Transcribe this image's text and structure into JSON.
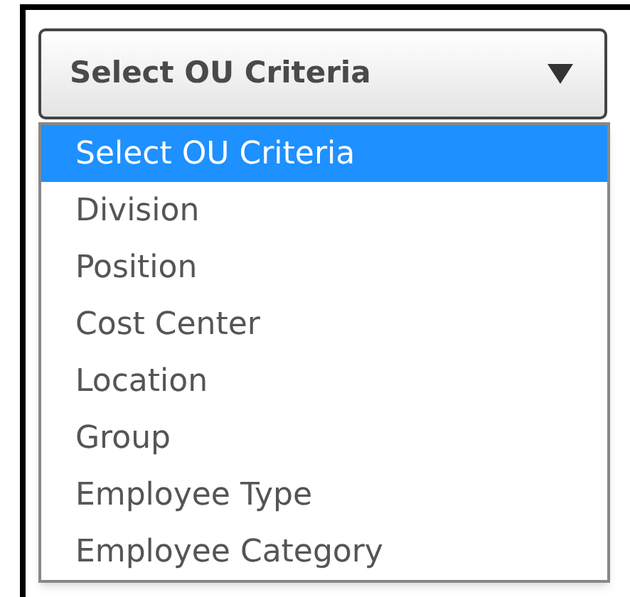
{
  "select": {
    "value": "Select OU Criteria"
  },
  "options": [
    {
      "label": "Select OU Criteria",
      "selected": true
    },
    {
      "label": "Division",
      "selected": false
    },
    {
      "label": "Position",
      "selected": false
    },
    {
      "label": "Cost Center",
      "selected": false
    },
    {
      "label": "Location",
      "selected": false
    },
    {
      "label": "Group",
      "selected": false
    },
    {
      "label": "Employee Type",
      "selected": false
    },
    {
      "label": "Employee Category",
      "selected": false
    }
  ]
}
